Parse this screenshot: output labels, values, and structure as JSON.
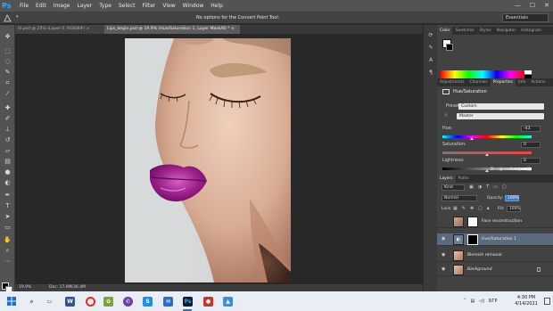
{
  "app": {
    "logo": "Ps",
    "menu": [
      "File",
      "Edit",
      "Image",
      "Layer",
      "Type",
      "Select",
      "Filter",
      "View",
      "Window",
      "Help"
    ],
    "window_controls": [
      "—",
      "☐",
      "✕"
    ]
  },
  "options_bar": {
    "message": "No options for the Convert Point Tool.",
    "workspace": "Essentials"
  },
  "tabs": [
    {
      "label": "lit.psd @ 25% (Layer 0, RGB/8#) ×",
      "active": false
    },
    {
      "label": "Lips_begin.psd @ 19.9% (Hue/Saturation 1, Layer Mask/8) * ×",
      "active": true
    }
  ],
  "status": {
    "zoom": "19.9%",
    "doc": "Doc: 17.9M/36.4M"
  },
  "panels": {
    "color_tabs": [
      "Color",
      "Swatches",
      "Styles",
      "Navigator",
      "Histogram"
    ],
    "adjust_tabs": [
      "Adjustments",
      "Channels",
      "Properties",
      "Info",
      "Actions"
    ],
    "properties_title": "Hue/Saturation",
    "preset_label": "Preset:",
    "preset_value": "Custom",
    "channel_value": "Master",
    "hue_label": "Hue:",
    "hue_value": "-43",
    "saturation_label": "Saturation:",
    "saturation_value": "0",
    "lightness_label": "Lightness:",
    "lightness_value": "0",
    "layers_tabs": [
      "Layers",
      "Paths"
    ],
    "kind_label": "Kind",
    "blend_mode": "Normal",
    "opacity_label": "Opacity:",
    "opacity_value": "100%",
    "lock_label": "Lock:",
    "fill_label": "Fill:",
    "fill_value": "100%"
  },
  "layers": [
    {
      "name": "Face reconstruction",
      "selected": false,
      "visible": false,
      "locked": false
    },
    {
      "name": "Hue/Saturation 1",
      "selected": true,
      "visible": true,
      "locked": false
    },
    {
      "name": "Blemish removal",
      "selected": false,
      "visible": true,
      "locked": false
    },
    {
      "name": "Background",
      "selected": false,
      "visible": true,
      "locked": true
    }
  ],
  "taskbar": {
    "tray_lang": "БГР",
    "time": "4:30 PM",
    "date": "4/14/2021"
  },
  "colors": {
    "menubar": "#535353",
    "panel": "#424242",
    "selected_layer": "#5b6b7d",
    "accent": "#3b7bd1"
  }
}
